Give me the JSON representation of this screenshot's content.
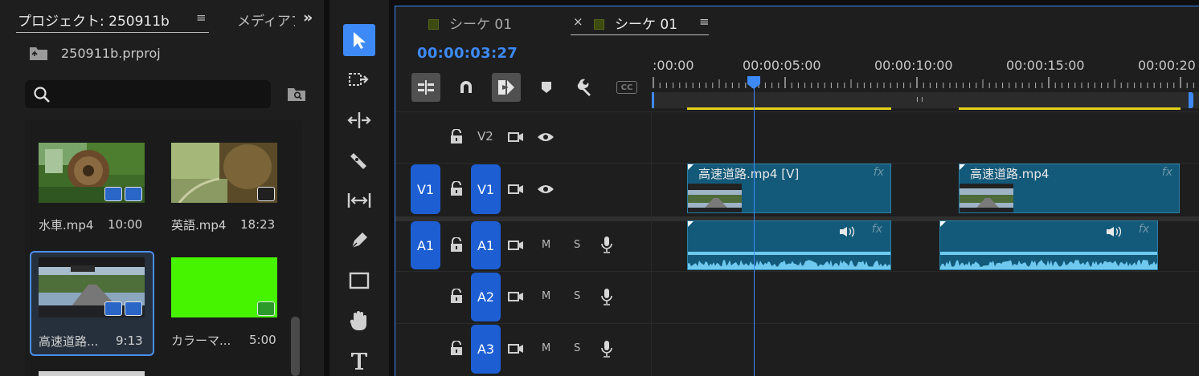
{
  "project_panel": {
    "tab_title": "プロジェクト: 250911b",
    "tab_menu": "≡",
    "tab2_title": "メディアブラウザー",
    "expand_glyph": "»",
    "project_file": "250911b.prproj",
    "search_placeholder": "",
    "clips": [
      {
        "name": "水車.mp4",
        "duration": "10:00"
      },
      {
        "name": "英語.mp4",
        "duration": "18:23"
      },
      {
        "name": "高速道路...",
        "duration": "9:13"
      },
      {
        "name": "カラーマ...",
        "duration": "5:00"
      }
    ]
  },
  "tools": [
    "selection-tool",
    "track-select-forward-tool",
    "ripple-edit-tool",
    "razor-tool",
    "slip-tool",
    "pen-tool",
    "rectangle-tool",
    "hand-tool",
    "type-tool"
  ],
  "timeline": {
    "tabs": [
      {
        "label": "シーケ 01"
      },
      {
        "label": "シーケ 01"
      }
    ],
    "close_glyph": "×",
    "menu_glyph": "≡",
    "timecode": "00:00:03:27",
    "ruler_labels": [
      ":00:00",
      "00:00:05:00",
      "00:00:10:00",
      "00:00:15:00",
      "00:00:20"
    ],
    "toggle_cc": "CC",
    "tracks": {
      "v2": {
        "label": "V2"
      },
      "v1": {
        "source": "V1",
        "label": "V1"
      },
      "a1": {
        "source": "A1",
        "label": "A1",
        "mute": "M",
        "solo": "S"
      },
      "a2": {
        "label": "A2",
        "mute": "M",
        "solo": "S"
      },
      "a3": {
        "label": "A3",
        "mute": "M",
        "solo": "S"
      }
    },
    "clips": {
      "v1_clip1": "高速道路.mp4 [V]",
      "v1_clip2": "高速道路.mp4",
      "fx": "fx"
    },
    "colors": {
      "accent": "#3d8af7",
      "clip": "#135a7a",
      "work_area": "#e3d21a",
      "target": "#1d5fd3"
    }
  }
}
